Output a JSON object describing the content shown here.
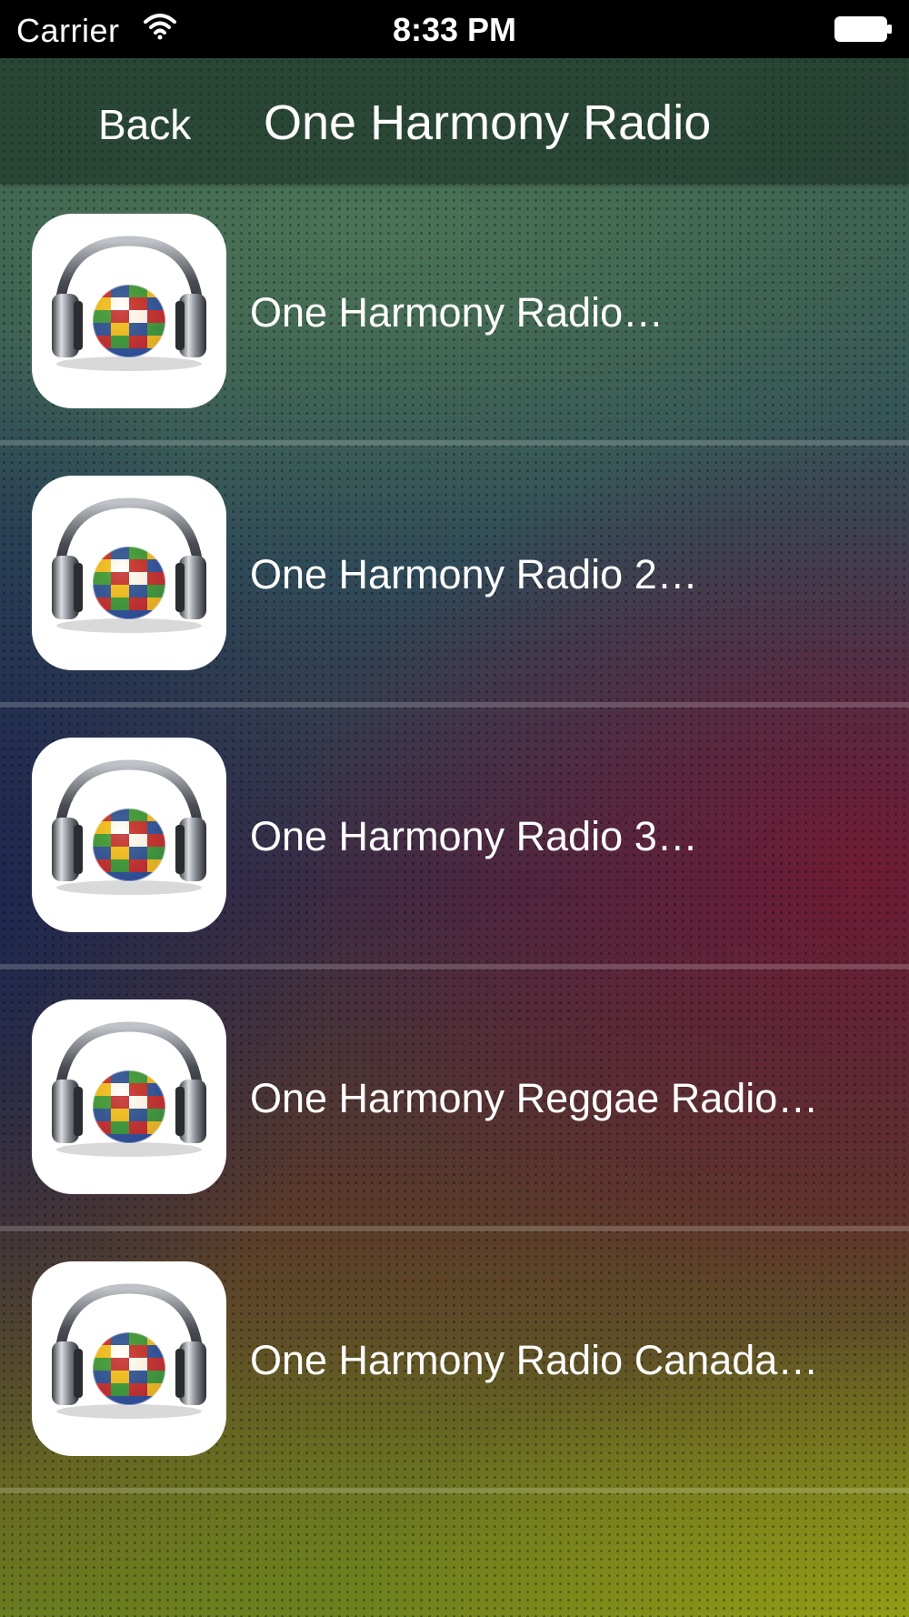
{
  "status_bar": {
    "carrier": "Carrier",
    "time": "8:33 PM",
    "wifi_icon": "wifi-icon",
    "battery_icon": "battery-icon"
  },
  "nav_bar": {
    "back_label": "Back",
    "title": "One Harmony Radio"
  },
  "stations": [
    {
      "label": "One Harmony Radio…",
      "icon": "headphones-globe-icon"
    },
    {
      "label": "One Harmony Radio 2…",
      "icon": "headphones-globe-icon"
    },
    {
      "label": "One Harmony Radio 3…",
      "icon": "headphones-globe-icon"
    },
    {
      "label": "One Harmony Reggae Radio…",
      "icon": "headphones-globe-icon"
    },
    {
      "label": "One Harmony Radio Canada…",
      "icon": "headphones-globe-icon"
    }
  ]
}
